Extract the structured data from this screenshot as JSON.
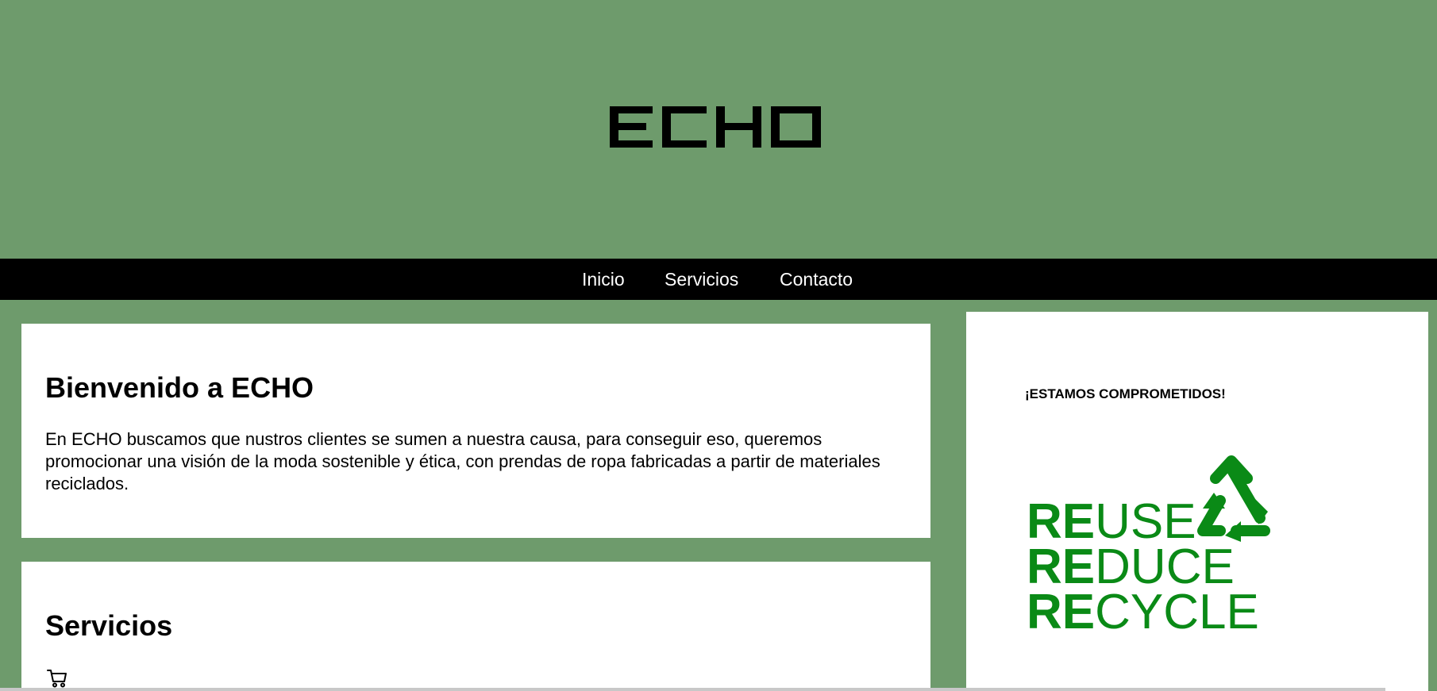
{
  "header": {
    "logo_text": "ECHO"
  },
  "nav": {
    "items": [
      {
        "label": "Inicio"
      },
      {
        "label": "Servicios"
      },
      {
        "label": "Contacto"
      }
    ]
  },
  "welcome": {
    "title": "Bienvenido a ECHO",
    "body": "En ECHO buscamos que nustros clientes se sumen a nuestra causa, para conseguir eso, queremos promocionar una visión de la moda sostenible y ética, con prendas de ropa fabricadas a partir de materiales reciclados."
  },
  "services": {
    "title": "Servicios",
    "icon": "cart-icon"
  },
  "sidebar": {
    "title": "¡ESTAMOS COMPROMETIDOS!",
    "image_lines": [
      {
        "prefix": "RE",
        "rest": "USE"
      },
      {
        "prefix": "RE",
        "rest": "DUCE"
      },
      {
        "prefix": "RE",
        "rest": "CYCLE"
      }
    ],
    "image_icon": "recycle-icon"
  },
  "colors": {
    "background": "#6e9b6c",
    "nav": "#000000",
    "panel": "#ffffff",
    "accent_green": "#0a8a16"
  }
}
